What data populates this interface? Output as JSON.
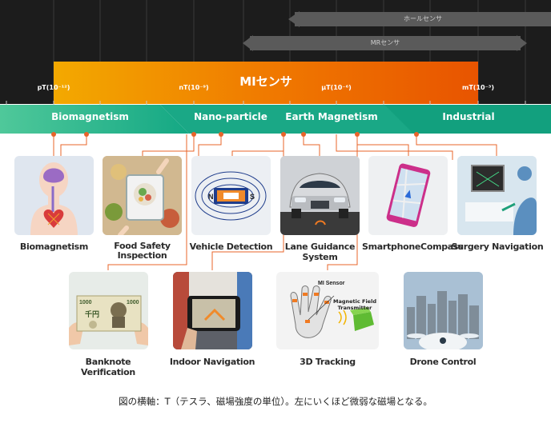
{
  "scale": {
    "hall_sensor": "ホールセンサ",
    "mr_sensor": "MRセンサ",
    "mi_sensor": "MIセンサ",
    "ticks": [
      "pT(10⁻¹²)",
      "nT(10⁻⁹)",
      "µT(10⁻⁶)",
      "mT(10⁻³)"
    ]
  },
  "bands": [
    "Biomagnetism",
    "Nano-particle",
    "Earth Magnetism",
    "Industrial"
  ],
  "apps_row1": [
    "Biomagnetism",
    "Food Safety\nInspection",
    "Vehicle Detection",
    "Lane Guidance System",
    "SmartphoneCompass",
    "Surgery Navigation"
  ],
  "apps_row2": [
    "Banknote Verification",
    "Indoor Navigation",
    "3D Tracking",
    "Drone Control"
  ],
  "tracking_labels": {
    "mi_sensor": "MI Sensor",
    "magnetic_field_transmitter": "Magnetic Field\nTransmitter"
  },
  "magnet_labels": {
    "north": "N",
    "south": "S"
  },
  "banknote_text": {
    "value": "1000",
    "denomination": "千円"
  },
  "footnote": "図の横軸：T（テスラ、磁場強度の単位）。左にいくほど微弱な磁場となる。",
  "colors": {
    "dark_bg": "#1c1c1c",
    "orange_left": "#f5a800",
    "orange_right": "#e85a00",
    "teal": "#1fae8a",
    "connector": "#e8642a"
  }
}
